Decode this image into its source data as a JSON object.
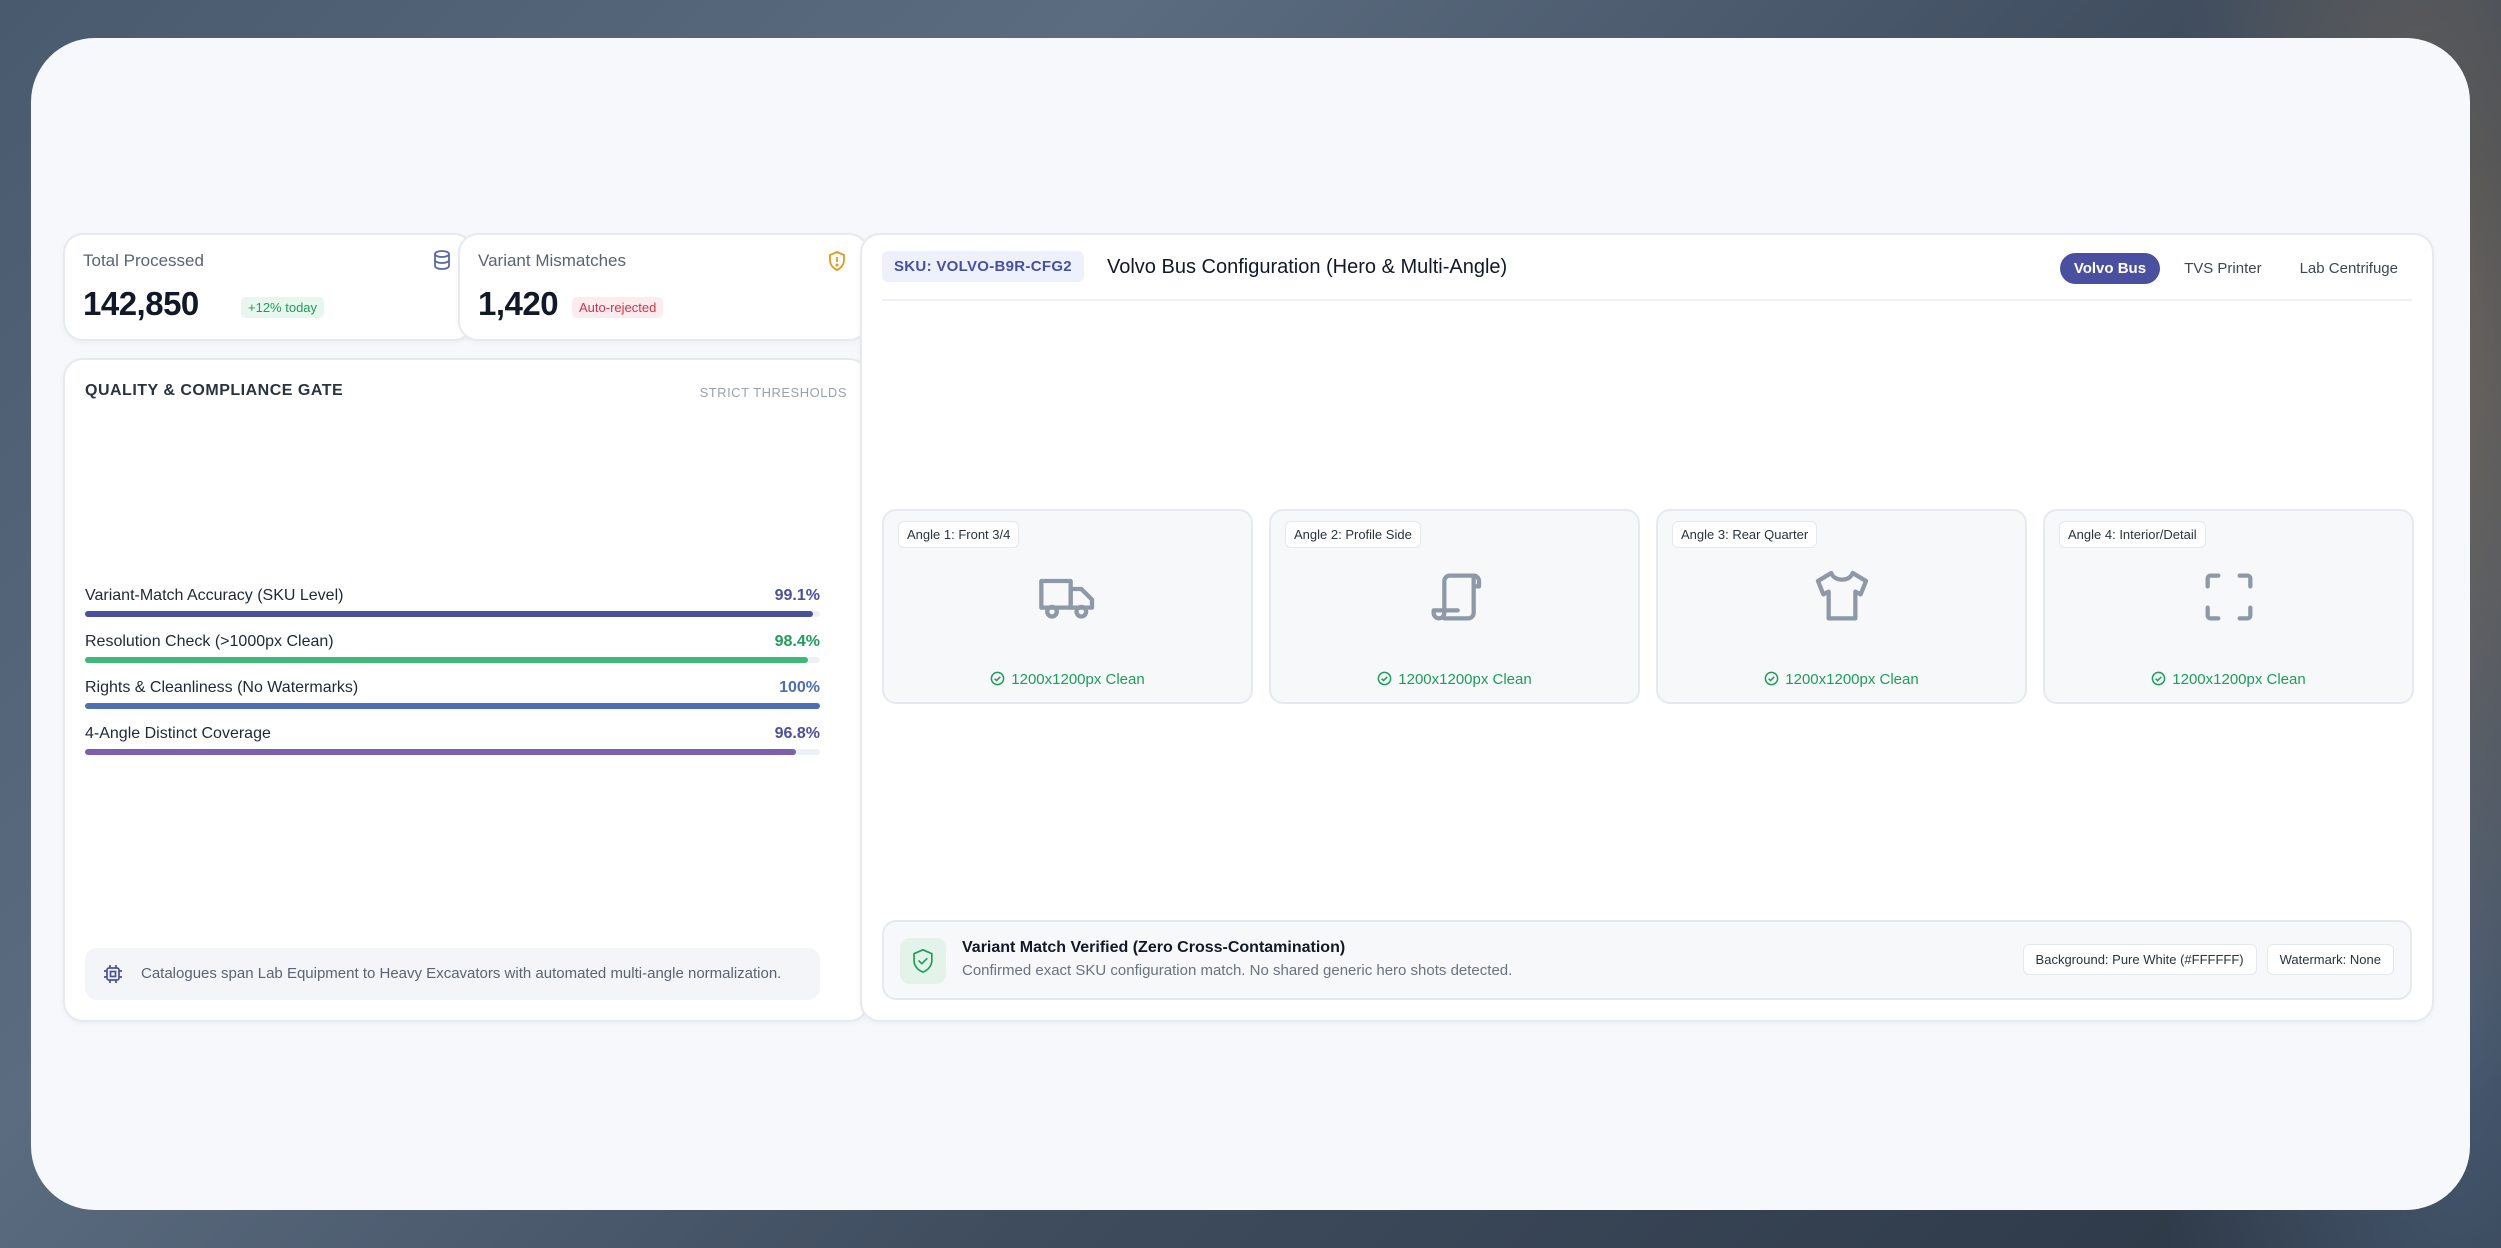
{
  "stats": {
    "total": {
      "label": "Total Processed",
      "value": "142,850",
      "badge": "+12% today",
      "icon": "database-icon"
    },
    "mismatch": {
      "label": "Variant Mismatches",
      "value": "1,420",
      "badge": "Auto-rejected",
      "icon": "shield-alert-icon"
    }
  },
  "quality_gate": {
    "title": "QUALITY & COMPLIANCE GATE",
    "subtitle": "STRICT THRESHOLDS",
    "metrics": [
      {
        "label": "Variant-Match Accuracy (SKU Level)",
        "value": "99.1%",
        "fraction": 0.991,
        "color": "#4b4fa0"
      },
      {
        "label": "Resolution Check (>1000px Clean)",
        "value": "98.4%",
        "fraction": 0.984,
        "color": "#3fb87a"
      },
      {
        "label": "Rights & Cleanliness (No Watermarks)",
        "value": "100%",
        "fraction": 1.0,
        "color": "#4f6fb3"
      },
      {
        "label": "4-Angle Distinct Coverage",
        "value": "96.8%",
        "fraction": 0.968,
        "color": "#7b5fb0"
      }
    ],
    "note": "Catalogues span Lab Equipment to Heavy Excavators with automated multi-angle normalization."
  },
  "main": {
    "sku": "SKU: VOLVO-B9R-CFG2",
    "title": "Volvo Bus Configuration (Hero & Multi-Angle)",
    "tabs": [
      {
        "label": "Volvo Bus",
        "active": true
      },
      {
        "label": "TVS Printer",
        "active": false
      },
      {
        "label": "Lab Centrifuge",
        "active": false
      }
    ],
    "angles": [
      {
        "label": "Angle 1: Front 3/4",
        "icon": "truck-icon",
        "status": "1200x1200px Clean"
      },
      {
        "label": "Angle 2: Profile Side",
        "icon": "scroll-icon",
        "status": "1200x1200px Clean"
      },
      {
        "label": "Angle 3: Rear Quarter",
        "icon": "shirt-icon",
        "status": "1200x1200px Clean"
      },
      {
        "label": "Angle 4: Interior/Detail",
        "icon": "focus-frame-icon",
        "status": "1200x1200px Clean"
      }
    ],
    "verify": {
      "title": "Variant Match Verified (Zero Cross-Contamination)",
      "desc": "Confirmed exact SKU configuration match. No shared generic hero shots detected.",
      "tags": [
        "Background: Pure White (#FFFFFF)",
        "Watermark: None"
      ]
    }
  }
}
